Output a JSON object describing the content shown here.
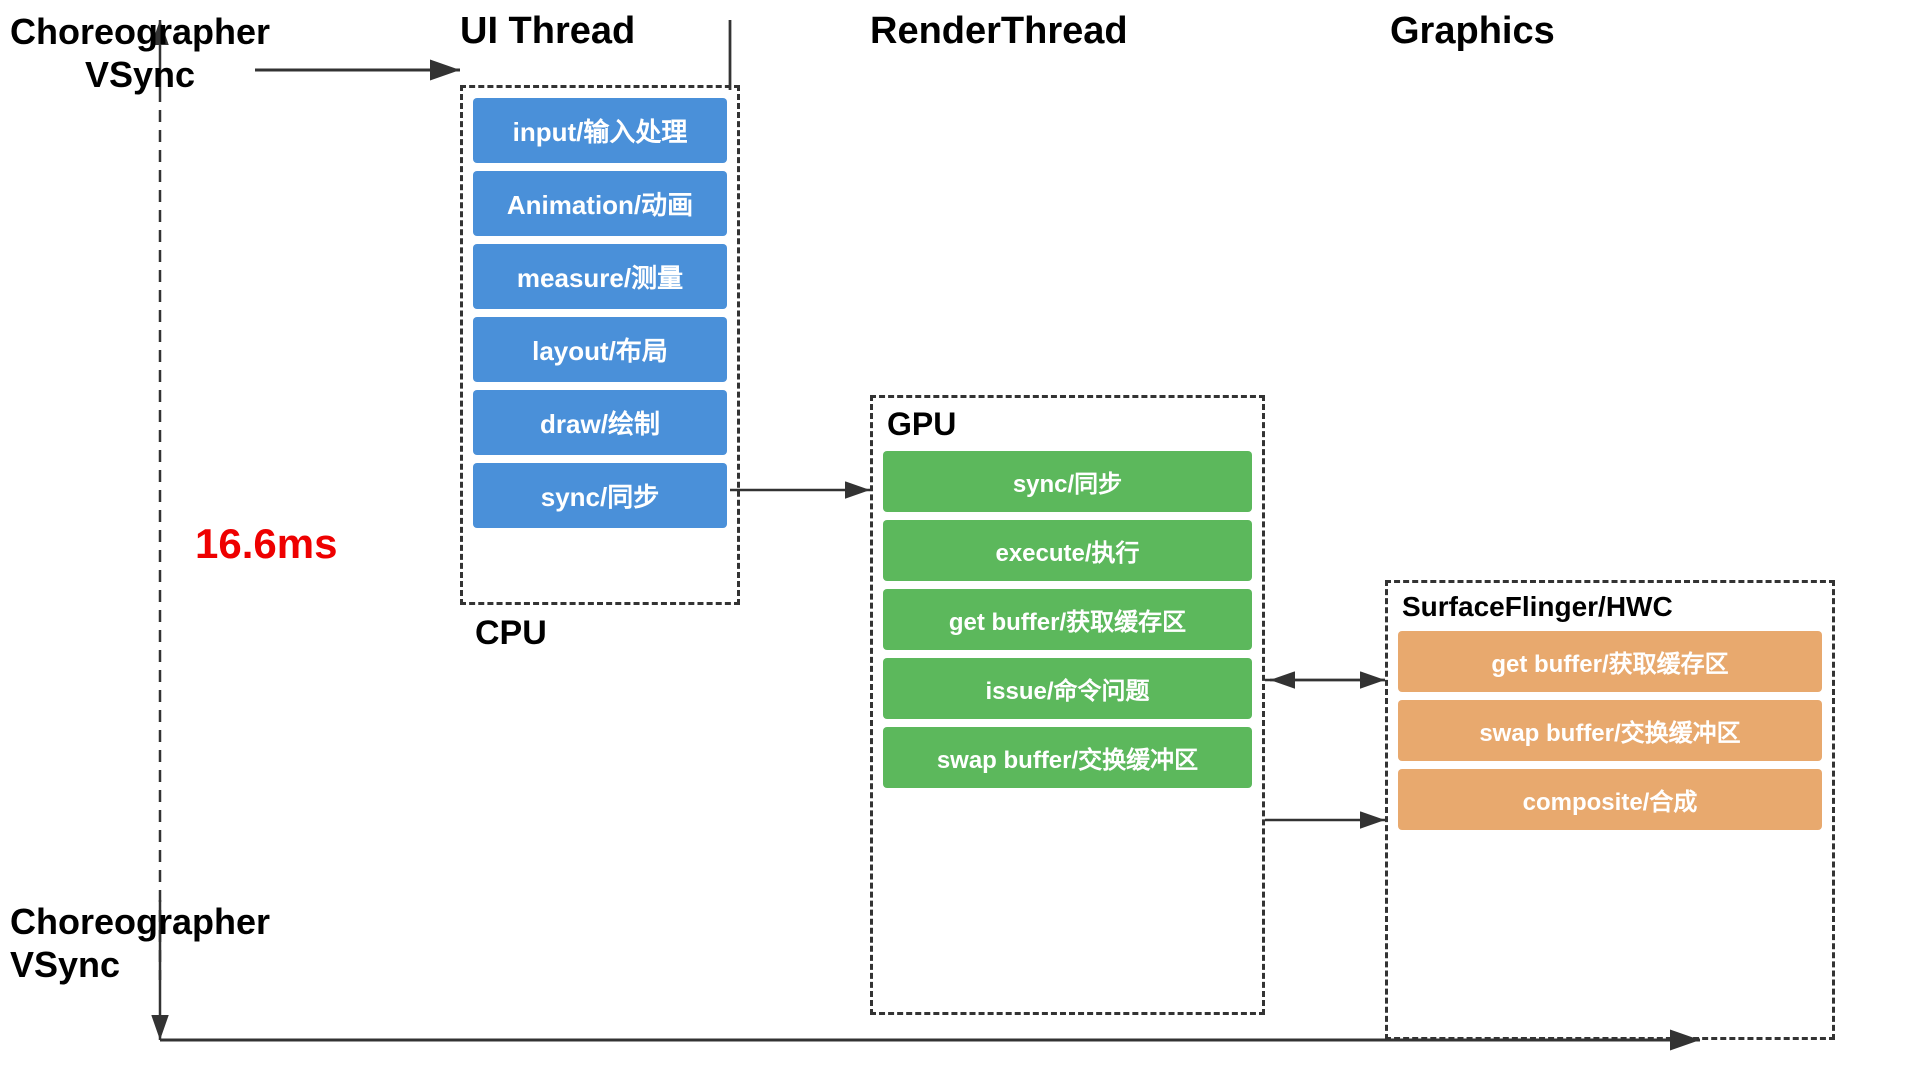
{
  "headers": {
    "choreographer": "Choreographer\nVSync",
    "ui_thread": "UI Thread",
    "render_thread": "RenderThread",
    "graphics": "Graphics"
  },
  "cpu_label": "CPU",
  "gpu_label": "GPU",
  "surfaceflinger_label": "SurfaceFlinger/HWC",
  "timing": "16.6ms",
  "ui_blocks": [
    "input/输入处理",
    "Animation/动画",
    "measure/测量",
    "layout/布局",
    "draw/绘制",
    "sync/同步"
  ],
  "gpu_blocks": [
    "sync/同步",
    "execute/执行",
    "get buffer/获取缓存区",
    "issue/命令问题",
    "swap buffer/交换缓冲区"
  ],
  "sf_blocks": [
    "get buffer/获取缓存区",
    "swap buffer/交换缓冲区",
    "composite/合成"
  ],
  "vsync_bottom": "Choreographer\nVSync"
}
